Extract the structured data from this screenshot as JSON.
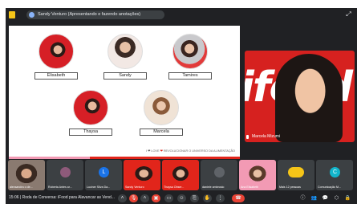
{
  "topbar": {
    "presenting_label": "Sandy Venturo (Apresentando e fazendo anotações)"
  },
  "slide": {
    "people": [
      {
        "name": "Elisabeth"
      },
      {
        "name": "Sandy"
      },
      {
        "name": "Tamires"
      },
      {
        "name": "Thaysa"
      },
      {
        "name": "Marcela"
      }
    ],
    "footer_prefix": "I ❤ LOVE",
    "footer_heart": "❤",
    "footer_text": "REVOLUCIONAR O UNIVERSO DA ALIMENTAÇÃO"
  },
  "speaker": {
    "name": "Marcela Mizumi",
    "logo_text": "ifood"
  },
  "participants": [
    {
      "name": "alexsandra o de...",
      "type": "camera"
    },
    {
      "name": "Roberta Antes ar...",
      "type": "avatar",
      "initial": "",
      "color": "#8e5a7a"
    },
    {
      "name": "Luciner Silva Da...",
      "type": "avatar",
      "initial": "L",
      "color": "#1a73e8"
    },
    {
      "name": "Sandy Venturo",
      "type": "camera"
    },
    {
      "name": "Thaysa Obser...",
      "type": "camera"
    },
    {
      "name": "daniele ambrosio",
      "type": "avatar",
      "initial": "",
      "color": "#5f6368"
    },
    {
      "name": "Ana Elisabeth",
      "type": "camera"
    },
    {
      "name": "Mais 12 pessoas",
      "type": "avatar",
      "initial": "",
      "color": "#f5c518"
    },
    {
      "name": "Comunicação M...",
      "type": "avatar",
      "initial": "C",
      "color": "#12b5cb"
    }
  ],
  "bottombar": {
    "time": "15:06",
    "meeting_title": "Roda de Conversa: iFood para Alavancar as Vend..."
  }
}
